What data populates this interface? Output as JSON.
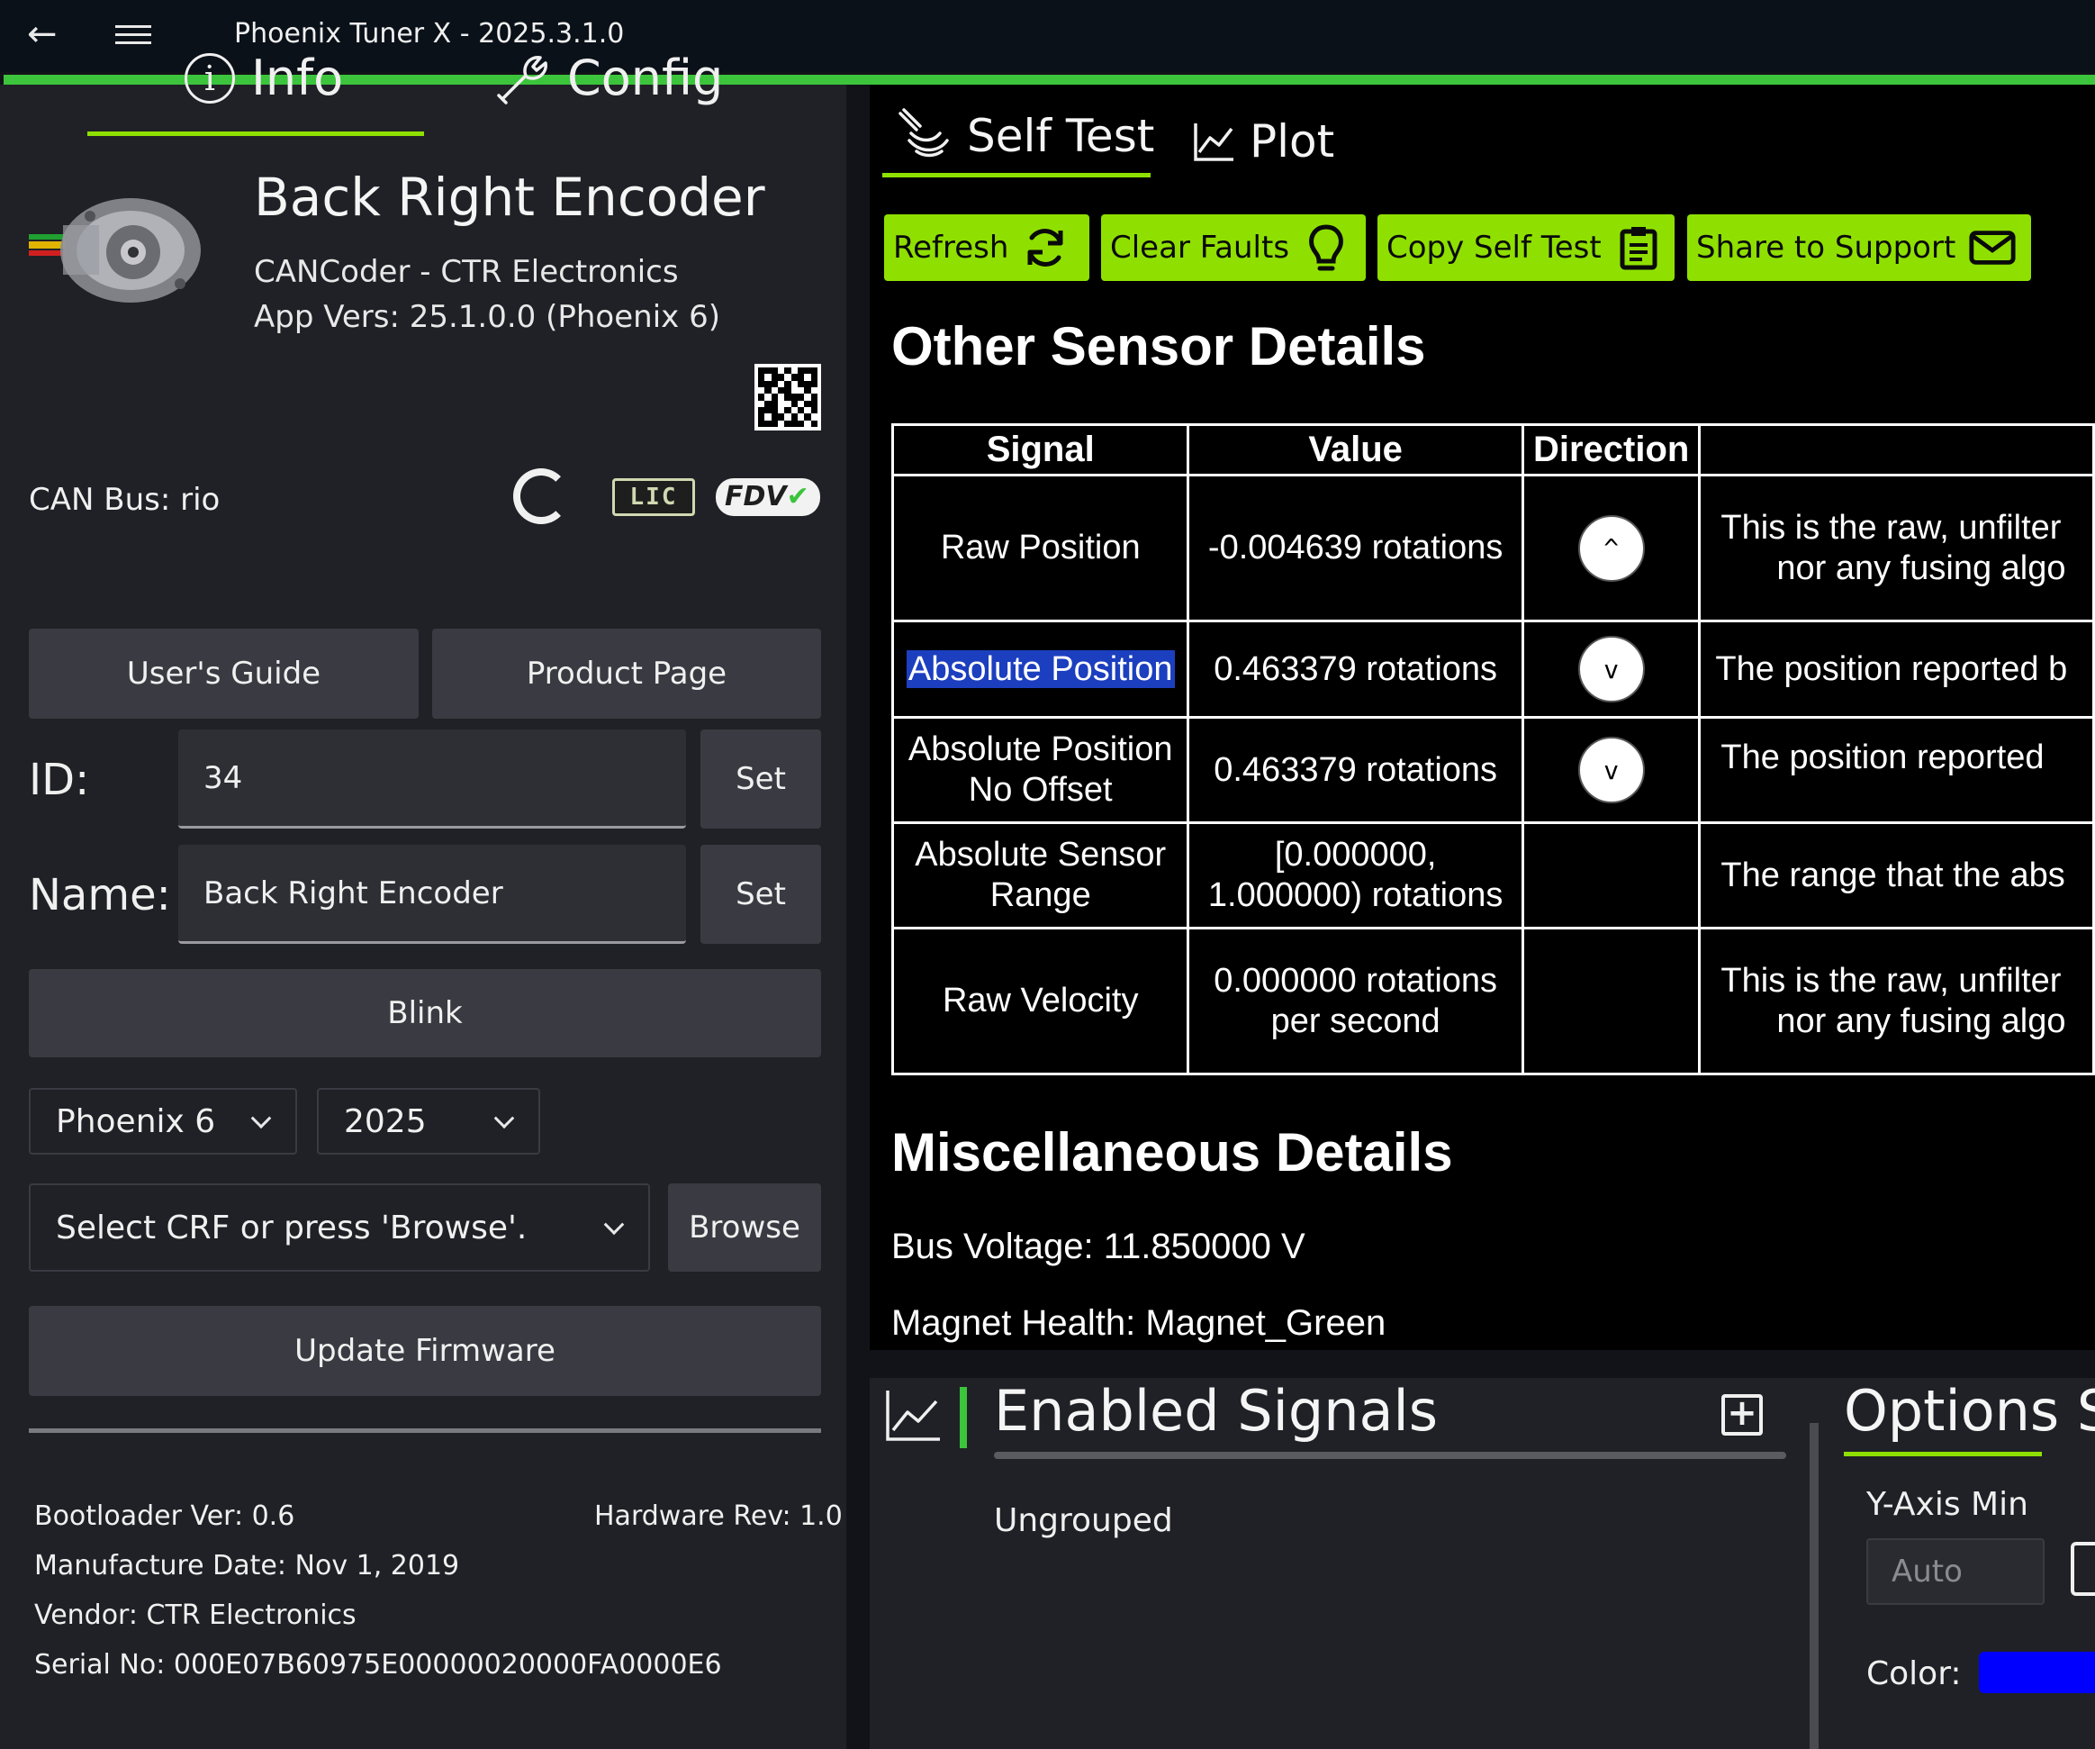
{
  "titlebar": {
    "title": "Phoenix Tuner X - 2025.3.1.0"
  },
  "left": {
    "tabs": {
      "info": "Info",
      "config": "Config"
    },
    "device": {
      "name": "Back Right Encoder",
      "model": "CANCoder - CTR Electronics",
      "version": "App Vers: 25.1.0.0 (Phoenix 6)"
    },
    "can_bus": "CAN Bus: rio",
    "badges": {
      "lic": "LIC",
      "fdv": "FDV"
    },
    "buttons": {
      "guide": "User's Guide",
      "product": "Product Page",
      "set": "Set",
      "blink": "Blink",
      "browse": "Browse",
      "update": "Update Firmware"
    },
    "id": {
      "label": "ID:",
      "value": "34"
    },
    "name": {
      "label": "Name:",
      "value": "Back Right Encoder"
    },
    "selects": {
      "phoenix": "Phoenix 6",
      "year": "2025",
      "crf": "Select CRF or press 'Browse'."
    },
    "meta": {
      "bootloader": "Bootloader Ver: 0.6",
      "hardware": "Hardware Rev: 1.0",
      "manufacture": "Manufacture Date: Nov 1, 2019",
      "vendor": "Vendor: CTR Electronics",
      "serial": "Serial No: 000E07B60975E00000020000FA0000E6"
    }
  },
  "right": {
    "tabs": {
      "self_test": "Self Test",
      "plot": "Plot"
    },
    "actions": {
      "refresh": "Refresh",
      "clear": "Clear Faults",
      "copy": "Copy Self Test",
      "share": "Share to Support"
    },
    "other_heading": "Other Sensor Details",
    "table": {
      "headers": [
        "Signal",
        "Value",
        "Direction",
        ""
      ],
      "rows": [
        {
          "signal": "Raw Position",
          "value": "-0.004639 rotations",
          "dir": "^",
          "desc1": "This is the raw, unfilter",
          "desc2": "nor any fusing algo"
        },
        {
          "signal": "Absolute Position",
          "value": "0.463379 rotations",
          "dir": "v",
          "desc1": "The position reported b",
          "desc2": ""
        },
        {
          "signal1": "Absolute Position",
          "signal2": "No Offset",
          "value": "0.463379 rotations",
          "dir": "v",
          "desc1": "The position reported",
          "desc2": ""
        },
        {
          "signal1": "Absolute Sensor",
          "signal2": "Range",
          "value1": "[0.000000,",
          "value2": "1.000000) rotations",
          "dir": "",
          "desc1": "The range that the abs",
          "desc2": ""
        },
        {
          "signal": "Raw Velocity",
          "value1": "0.000000 rotations",
          "value2": "per second",
          "dir": "",
          "desc1": "This is the raw, unfilter",
          "desc2": "nor any fusing algo"
        }
      ]
    },
    "misc_heading": "Miscellaneous Details",
    "bus_voltage": "Bus Voltage: 11.850000 V",
    "magnet_health": "Magnet Health: Magnet_Green"
  },
  "plot": {
    "enabled_signals": "Enabled Signals",
    "ungrouped": "Ungrouped",
    "options": "Options S",
    "y_axis_min": "Y-Axis Min",
    "auto": "Auto",
    "color": "Color:",
    "color_value": "#0000ff"
  }
}
